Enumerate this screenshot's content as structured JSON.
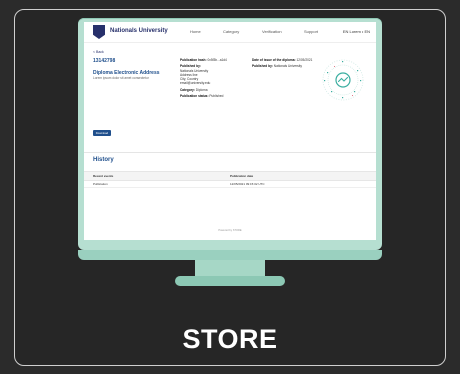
{
  "store_label": "STORE",
  "app": {
    "university": "Nationals University",
    "nav": [
      "Home",
      "Category",
      "Verification",
      "Support"
    ],
    "language": "EN Lorem • EN"
  },
  "doc": {
    "breadcrumb": "< Back",
    "id": "13142798",
    "title": "Diploma Electronic Address",
    "subtitle": "Lorem ipsum dolor sit amet consectetur",
    "button_label": "Download"
  },
  "details_mid": {
    "publication_label": "Publication hash:",
    "publication_value": "0x5f3b...a1d4",
    "publisher_label": "Published by:",
    "publisher_lines": [
      "Nationals University",
      "Address line",
      "City, Country",
      "email@university.edu"
    ],
    "category_label": "Category:",
    "category_value": "Diploma",
    "status_label": "Publication status:",
    "status_value": "Published"
  },
  "details_right": {
    "date_label": "Date of issue of the diploma:",
    "date_value": "12/05/2021",
    "issuer_label": "Published by:",
    "issuer_value": "Nationals University"
  },
  "history": {
    "heading": "History",
    "columns": [
      "Recent events",
      "Publication date"
    ],
    "rows": [
      [
        "Publication",
        "12/05/2021 09:15:02 UTC"
      ]
    ]
  },
  "footer": "Powered by STORE",
  "colors": {
    "accent": "#1f4f8c",
    "monitor": "#b6dfd1",
    "qr": "#3aaea0"
  }
}
